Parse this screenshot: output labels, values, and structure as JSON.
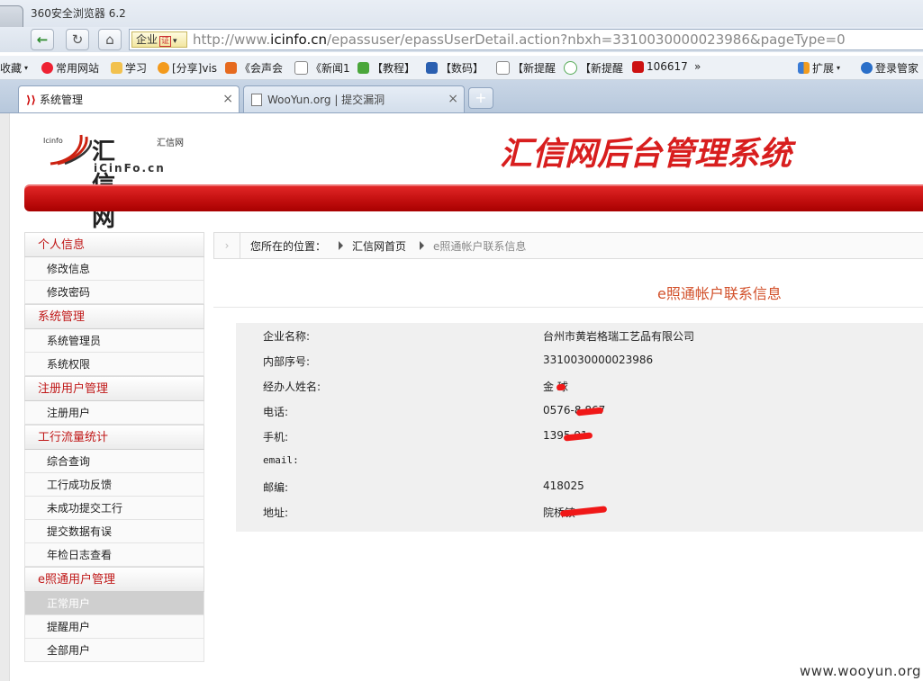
{
  "browser": {
    "window_title": "360安全浏览器 6.2",
    "address": {
      "cert_label": "企业",
      "cert_tag": "证",
      "url_prefix": "http://www.",
      "url_domain": "icinfo.cn",
      "url_rest": "/epassuser/epassUserDetail.action?nbxh=3310030000023986&pageType=0"
    },
    "bookmarks": [
      {
        "label": "收藏",
        "icon": "dropdown-icon"
      },
      {
        "label": "常用网站",
        "icon": "weibo-icon"
      },
      {
        "label": "学习",
        "icon": "folder-icon"
      },
      {
        "label": "[分享]vis",
        "icon": "share-icon"
      },
      {
        "label": "《会声会",
        "icon": "shield-icon"
      },
      {
        "label": "《新闻1",
        "icon": "page-icon"
      },
      {
        "label": "【教程】",
        "icon": "green-icon"
      },
      {
        "label": "【数码】",
        "icon": "paw-icon"
      },
      {
        "label": "【新提醒",
        "icon": "page-icon"
      },
      {
        "label": "【新提醒",
        "icon": "circle-icon"
      },
      {
        "label": "106617",
        "icon": "flag-icon"
      },
      {
        "label": "»",
        "icon": "more-icon"
      }
    ],
    "extensions_label": "扩展",
    "login_label": "登录管家",
    "tabs": [
      {
        "label": "系统管理",
        "active": true
      },
      {
        "label": "WooYun.org | 提交漏洞",
        "active": false
      }
    ],
    "newtab_label": "+"
  },
  "header": {
    "logo_small": "Icinfo",
    "logo_cn": "汇信网",
    "logo_side": "汇信网",
    "logo_domain": "iCinFo.cn",
    "banner": "汇信网后台管理系统"
  },
  "sidebar": {
    "sections": [
      {
        "title": "个人信息",
        "items": [
          {
            "label": "修改信息"
          },
          {
            "label": "修改密码"
          }
        ]
      },
      {
        "title": "系统管理",
        "items": [
          {
            "label": "系统管理员"
          },
          {
            "label": "系统权限"
          }
        ]
      },
      {
        "title": "注册用户管理",
        "items": [
          {
            "label": "注册用户"
          }
        ]
      },
      {
        "title": "工行流量统计",
        "items": [
          {
            "label": "综合查询"
          },
          {
            "label": "工行成功反馈"
          },
          {
            "label": "未成功提交工行"
          },
          {
            "label": "提交数据有误"
          },
          {
            "label": "年检日志查看"
          }
        ]
      },
      {
        "title": "e照通用户管理",
        "items": [
          {
            "label": "正常用户",
            "selected": true
          },
          {
            "label": "提醒用户"
          },
          {
            "label": "全部用户"
          }
        ]
      }
    ]
  },
  "breadcrumb": {
    "prefix": "您所在的位置：",
    "home": "汇信网首页",
    "current": "e照通帐户联系信息"
  },
  "content": {
    "title": "e照通帐户联系信息",
    "fields": [
      {
        "label": "企业名称:",
        "value": "台州市黄岩格瑞工艺品有限公司"
      },
      {
        "label": "内部序号:",
        "value": "3310030000023986"
      },
      {
        "label": "经办人姓名:",
        "value": "金 球"
      },
      {
        "label": "电话:",
        "value": "0576-8 867"
      },
      {
        "label": "手机:",
        "value": "1395 91"
      },
      {
        "label": "email:",
        "value": ""
      },
      {
        "label": "邮编:",
        "value": "418025"
      },
      {
        "label": "地址:",
        "value": "院桥镇"
      }
    ]
  },
  "watermark": "www.wooyun.org"
}
